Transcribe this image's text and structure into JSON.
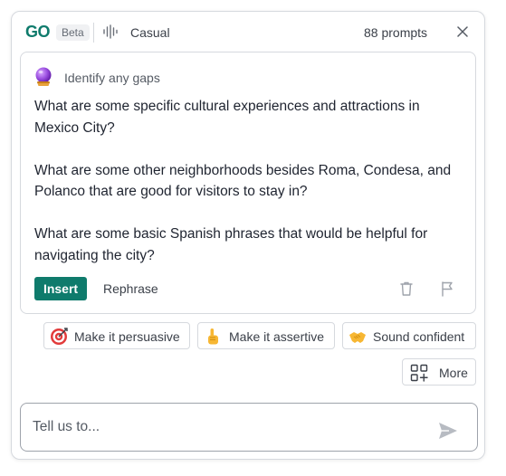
{
  "header": {
    "logo": "GO",
    "badge": "Beta",
    "tone_icon": "soundwave-icon",
    "tone": "Casual",
    "prompts_count": "88 prompts",
    "close_icon": "close-icon"
  },
  "card": {
    "icon": "crystal-ball-icon",
    "title": "Identify any gaps",
    "paragraphs": [
      "What are some specific cultural experiences and attractions in Mexico City?",
      "What are some other neighborhoods besides Roma, Condesa, and Polanco that are good for visitors to stay in?",
      "What are some basic Spanish phrases that would be helpful for navigating the city?"
    ],
    "insert_label": "Insert",
    "rephrase_label": "Rephrase",
    "trash_icon": "trash-icon",
    "flag_icon": "flag-icon"
  },
  "suggestions": [
    {
      "icon": "target-icon",
      "label": "Make it persuasive"
    },
    {
      "icon": "pointing-up-icon",
      "label": "Make it assertive"
    },
    {
      "icon": "handshake-icon",
      "label": "Sound confident"
    }
  ],
  "more": {
    "icon": "apps-plus-icon",
    "label": "More"
  },
  "input": {
    "placeholder": "Tell us to...",
    "value": "",
    "send_icon": "send-icon"
  },
  "colors": {
    "brand": "#0f7b6c",
    "border": "#d6d9de",
    "text": "#1f2430"
  }
}
